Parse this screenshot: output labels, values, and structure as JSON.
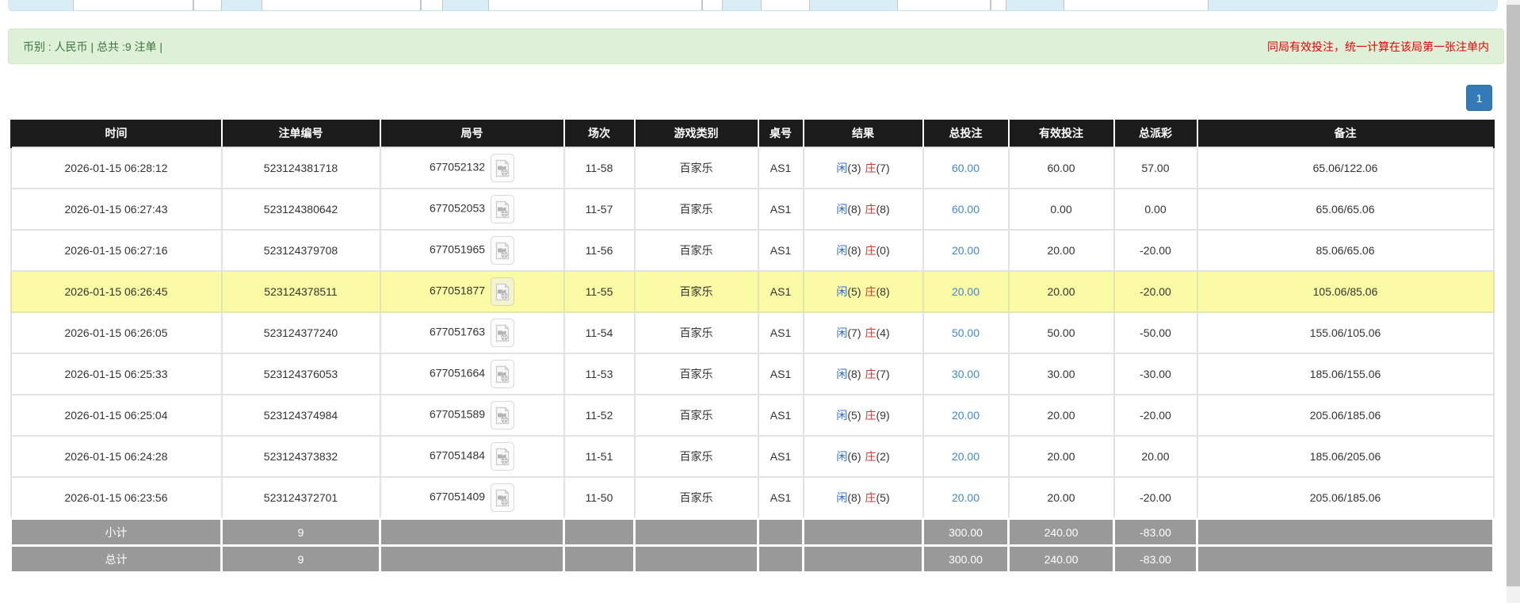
{
  "summary_bar": {
    "left_text": "币别 : 人民币 | 总共 :9 注单 |",
    "right_note": "同局有效投注，统一计算在该局第一张注单内"
  },
  "pagination": {
    "current_page": "1"
  },
  "colors": {
    "accent_blue": "#337ab7",
    "link_blue": "#3d87d6",
    "player_blue": "#2d6cdf",
    "banker_red": "#d9342b",
    "negative_red": "#e60000",
    "highlight_yellow": "#fbfba5",
    "header_bg": "#1c1c1c",
    "summary_row_gray": "#999999",
    "bar_green_bg": "#dff0d8",
    "bar_green_text": "#3c763d"
  },
  "table": {
    "headers": [
      {
        "key": "time",
        "label": "时间"
      },
      {
        "key": "bet_id",
        "label": "注单编号"
      },
      {
        "key": "round_id",
        "label": "局号"
      },
      {
        "key": "session",
        "label": "场次"
      },
      {
        "key": "game_type",
        "label": "游戏类别"
      },
      {
        "key": "table_no",
        "label": "桌号"
      },
      {
        "key": "result",
        "label": "结果"
      },
      {
        "key": "total_bet",
        "label": "总投注"
      },
      {
        "key": "valid_bet",
        "label": "有效投注"
      },
      {
        "key": "payout",
        "label": "总派彩"
      },
      {
        "key": "remark",
        "label": "备注"
      }
    ],
    "video_icon": "video-playback-icon",
    "rows": [
      {
        "time": "2026-01-15 06:28:12",
        "bet_id": "523124381718",
        "round_id": "677052132",
        "session": "11-58",
        "game_type": "百家乐",
        "table_no": "AS1",
        "result": {
          "player_label": "闲",
          "player_score": "(3)",
          "banker_label": "庄",
          "banker_score": "(7)"
        },
        "total_bet": "60.00",
        "valid_bet": "60.00",
        "payout": "57.00",
        "remark": "65.06/122.06",
        "highlighted": false
      },
      {
        "time": "2026-01-15 06:27:43",
        "bet_id": "523124380642",
        "round_id": "677052053",
        "session": "11-57",
        "game_type": "百家乐",
        "table_no": "AS1",
        "result": {
          "player_label": "闲",
          "player_score": "(8)",
          "banker_label": "庄",
          "banker_score": "(8)"
        },
        "total_bet": "60.00",
        "valid_bet": "0.00",
        "payout": "0.00",
        "remark": "65.06/65.06",
        "highlighted": false
      },
      {
        "time": "2026-01-15 06:27:16",
        "bet_id": "523124379708",
        "round_id": "677051965",
        "session": "11-56",
        "game_type": "百家乐",
        "table_no": "AS1",
        "result": {
          "player_label": "闲",
          "player_score": "(8)",
          "banker_label": "庄",
          "banker_score": "(0)"
        },
        "total_bet": "20.00",
        "valid_bet": "20.00",
        "payout": "-20.00",
        "remark": "85.06/65.06",
        "highlighted": false
      },
      {
        "time": "2026-01-15 06:26:45",
        "bet_id": "523124378511",
        "round_id": "677051877",
        "session": "11-55",
        "game_type": "百家乐",
        "table_no": "AS1",
        "result": {
          "player_label": "闲",
          "player_score": "(5)",
          "banker_label": "庄",
          "banker_score": "(8)"
        },
        "total_bet": "20.00",
        "valid_bet": "20.00",
        "payout": "-20.00",
        "remark": "105.06/85.06",
        "highlighted": true
      },
      {
        "time": "2026-01-15 06:26:05",
        "bet_id": "523124377240",
        "round_id": "677051763",
        "session": "11-54",
        "game_type": "百家乐",
        "table_no": "AS1",
        "result": {
          "player_label": "闲",
          "player_score": "(7)",
          "banker_label": "庄",
          "banker_score": "(4)"
        },
        "total_bet": "50.00",
        "valid_bet": "50.00",
        "payout": "-50.00",
        "remark": "155.06/105.06",
        "highlighted": false
      },
      {
        "time": "2026-01-15 06:25:33",
        "bet_id": "523124376053",
        "round_id": "677051664",
        "session": "11-53",
        "game_type": "百家乐",
        "table_no": "AS1",
        "result": {
          "player_label": "闲",
          "player_score": "(8)",
          "banker_label": "庄",
          "banker_score": "(7)"
        },
        "total_bet": "30.00",
        "valid_bet": "30.00",
        "payout": "-30.00",
        "remark": "185.06/155.06",
        "highlighted": false
      },
      {
        "time": "2026-01-15 06:25:04",
        "bet_id": "523124374984",
        "round_id": "677051589",
        "session": "11-52",
        "game_type": "百家乐",
        "table_no": "AS1",
        "result": {
          "player_label": "闲",
          "player_score": "(5)",
          "banker_label": "庄",
          "banker_score": "(9)"
        },
        "total_bet": "20.00",
        "valid_bet": "20.00",
        "payout": "-20.00",
        "remark": "205.06/185.06",
        "highlighted": false
      },
      {
        "time": "2026-01-15 06:24:28",
        "bet_id": "523124373832",
        "round_id": "677051484",
        "session": "11-51",
        "game_type": "百家乐",
        "table_no": "AS1",
        "result": {
          "player_label": "闲",
          "player_score": "(6)",
          "banker_label": "庄",
          "banker_score": "(2)"
        },
        "total_bet": "20.00",
        "valid_bet": "20.00",
        "payout": "20.00",
        "remark": "185.06/205.06",
        "highlighted": false
      },
      {
        "time": "2026-01-15 06:23:56",
        "bet_id": "523124372701",
        "round_id": "677051409",
        "session": "11-50",
        "game_type": "百家乐",
        "table_no": "AS1",
        "result": {
          "player_label": "闲",
          "player_score": "(8)",
          "banker_label": "庄",
          "banker_score": "(5)"
        },
        "total_bet": "20.00",
        "valid_bet": "20.00",
        "payout": "-20.00",
        "remark": "205.06/185.06",
        "highlighted": false
      }
    ],
    "summary_rows": [
      {
        "label": "小计",
        "count": "9",
        "total_bet": "300.00",
        "valid_bet": "240.00",
        "payout": "-83.00"
      },
      {
        "label": "总计",
        "count": "9",
        "total_bet": "300.00",
        "valid_bet": "240.00",
        "payout": "-83.00"
      }
    ]
  }
}
